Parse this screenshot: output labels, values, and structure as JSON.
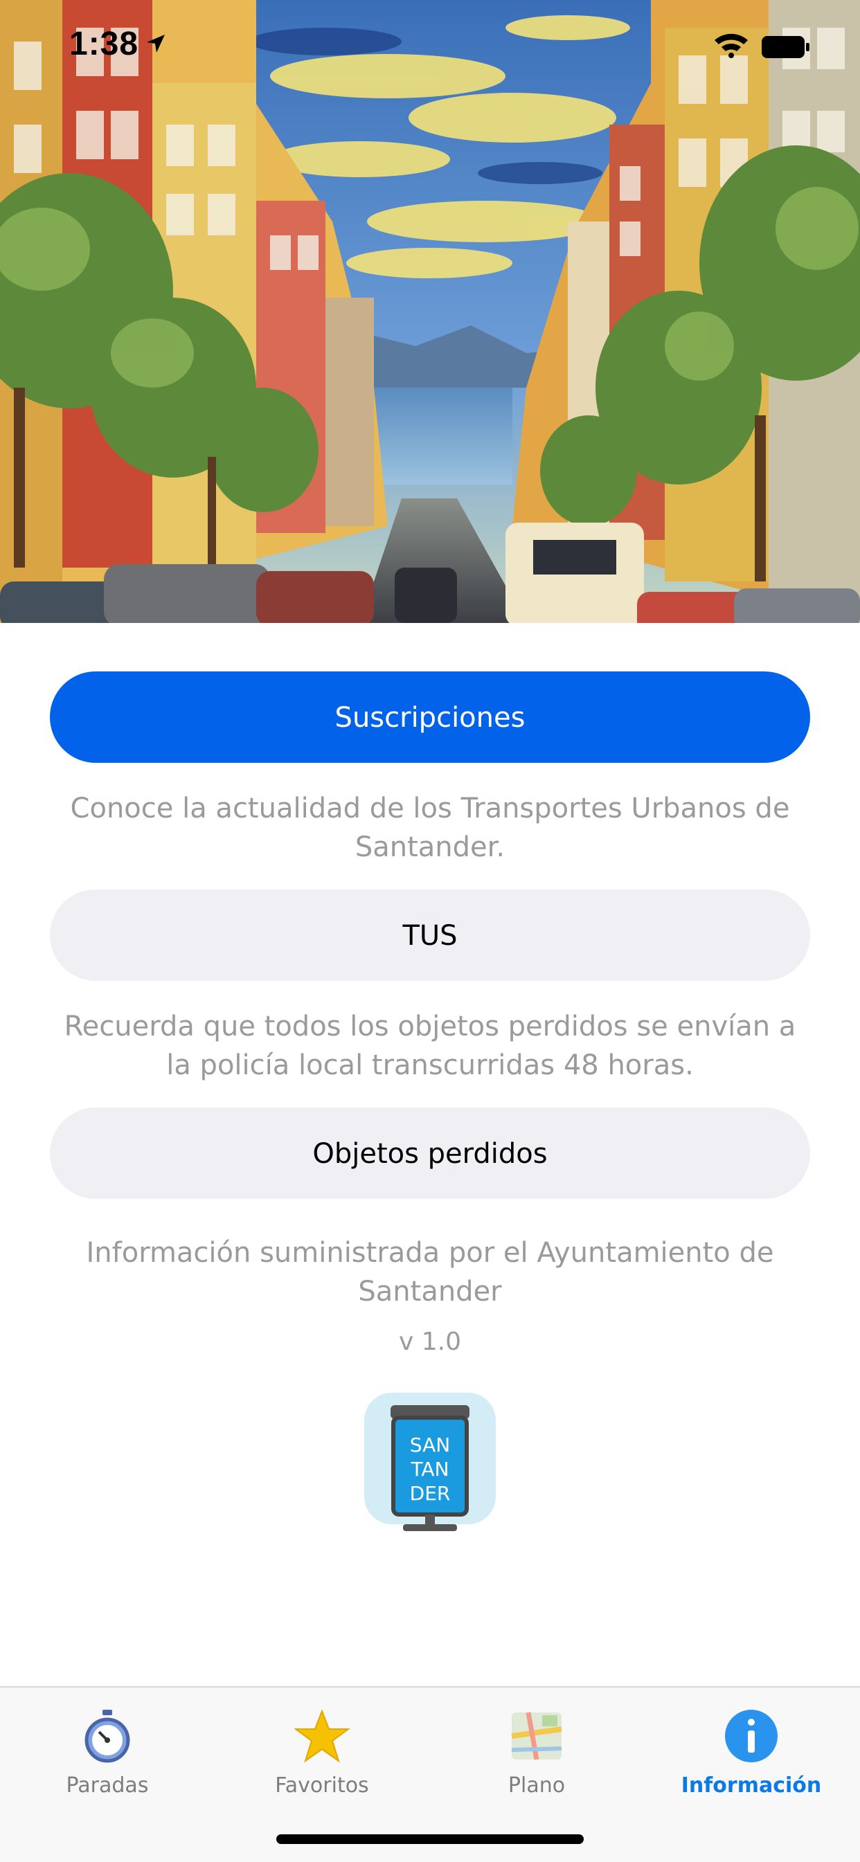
{
  "status_bar": {
    "time": "1:38"
  },
  "buttons": {
    "subscriptions_label": "Suscripciones",
    "tus_label": "TUS",
    "lost_objects_label": "Objetos perdidos"
  },
  "descriptions": {
    "tus_desc": "Conoce la actualidad de los Transportes Urbanos de Santander.",
    "lost_desc": "Recuerda que todos los objetos perdidos se envían a la policía local transcurridas 48 horas.",
    "info_desc": "Información suministrada por el Ayuntamiento de Santander"
  },
  "version": "v 1.0",
  "app_logo": {
    "line1": "SAN",
    "line2": "TAN",
    "line3": "DER"
  },
  "tab_bar": {
    "tabs": [
      {
        "label": "Paradas",
        "icon": "stopwatch-icon"
      },
      {
        "label": "Favoritos",
        "icon": "star-icon"
      },
      {
        "label": "Plano",
        "icon": "map-icon"
      },
      {
        "label": "Información",
        "icon": "info-icon"
      }
    ],
    "active_index": 3
  },
  "colors": {
    "primary_button": "#0362ea",
    "secondary_button": "#efeff4",
    "active_tab": "#0b7ae6",
    "inactive_tab": "#7d7d7d"
  }
}
